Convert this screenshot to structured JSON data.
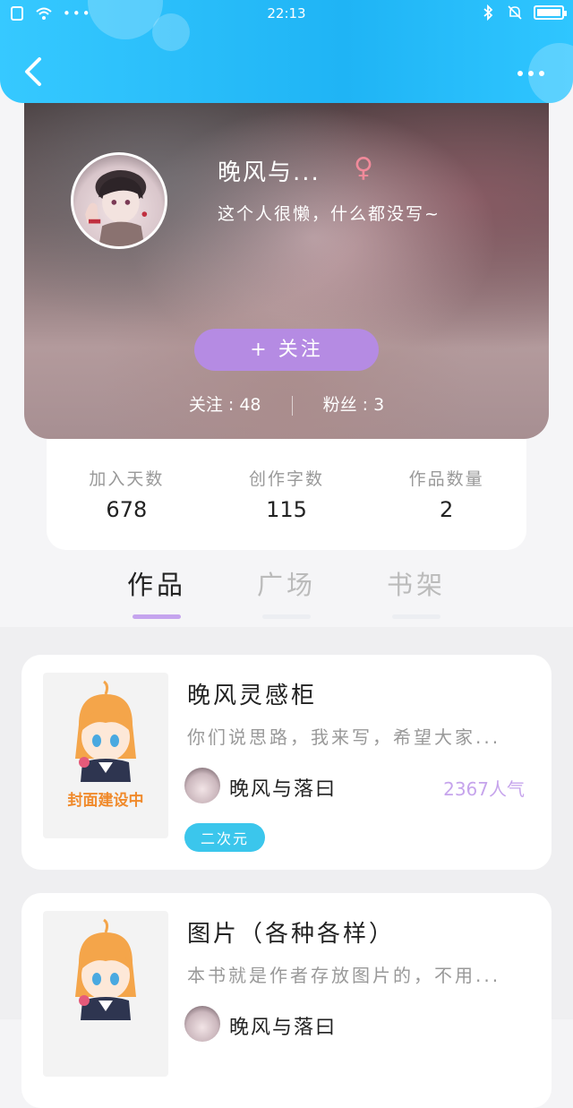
{
  "status_bar": {
    "time": "22:13",
    "battery_level_percent": 90
  },
  "profile": {
    "nickname": "晚风与...",
    "gender_symbol": "♀",
    "bio": "这个人很懒，什么都没写~",
    "follow_button": "+ 关注",
    "following_label": "关注",
    "following_count": "48",
    "followers_label": "粉丝",
    "followers_count": "3"
  },
  "stats": [
    {
      "label": "加入天数",
      "value": "678"
    },
    {
      "label": "创作字数",
      "value": "115"
    },
    {
      "label": "作品数量",
      "value": "2"
    }
  ],
  "tabs": [
    {
      "label": "作品",
      "active": true
    },
    {
      "label": "广场",
      "active": false
    },
    {
      "label": "书架",
      "active": false
    }
  ],
  "books": [
    {
      "cover_text": "封面建设中",
      "title": "晚风灵感柜",
      "description": "你们说思路，我来写，希望大家...",
      "author": "晚风与落曰",
      "popularity": "2367人气",
      "tag": "二次元"
    },
    {
      "cover_text": "",
      "title": "图片（各种各样）",
      "description": "本书就是作者存放图片的，不用...",
      "author": "晚风与落曰",
      "popularity": "",
      "tag": ""
    }
  ],
  "colors": {
    "header": "#1fb4f5",
    "follow_button": "#b58be3",
    "active_tab_bar": "#c5a4ee",
    "tag": "#3bc6ec",
    "popularity": "#c6a4ec",
    "cover_text": "#f08a2b"
  },
  "icons": [
    "back-arrow-icon",
    "more-dots-icon",
    "female-icon",
    "wifi-icon",
    "bluetooth-icon",
    "bell-muted-icon",
    "battery-icon"
  ]
}
